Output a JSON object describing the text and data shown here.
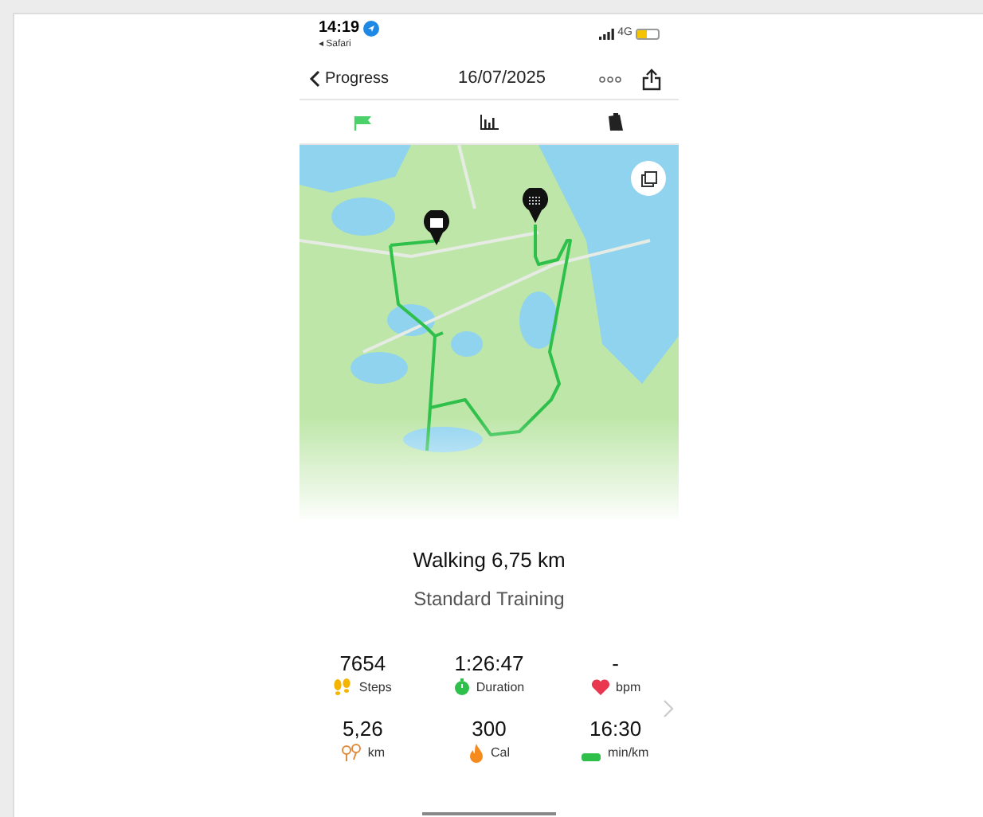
{
  "status_bar": {
    "time": "14:19",
    "back_app": "◂ Safari",
    "network": "4G",
    "battery": {
      "level": 0.45
    }
  },
  "nav": {
    "back": "Progress",
    "title": "16/07/2025"
  },
  "tabs": [
    {
      "kind": "route",
      "selected": true
    },
    {
      "kind": "chart",
      "selected": false
    },
    {
      "kind": "notes",
      "selected": false
    }
  ],
  "activity": {
    "title": "Walking 6,75 km",
    "subtitle": "Standard Training"
  },
  "stats": [
    {
      "kind": "steps",
      "value": "7654",
      "label": "Steps"
    },
    {
      "kind": "duration",
      "value": "1:26:47",
      "label": "Duration"
    },
    {
      "kind": "heart",
      "value": "-",
      "label": "bpm"
    },
    {
      "kind": "distance",
      "value": "5,26",
      "label": "km"
    },
    {
      "kind": "calories",
      "value": "300",
      "label": "Cal"
    },
    {
      "kind": "pace",
      "value": "16:30",
      "label": "min/km"
    }
  ]
}
